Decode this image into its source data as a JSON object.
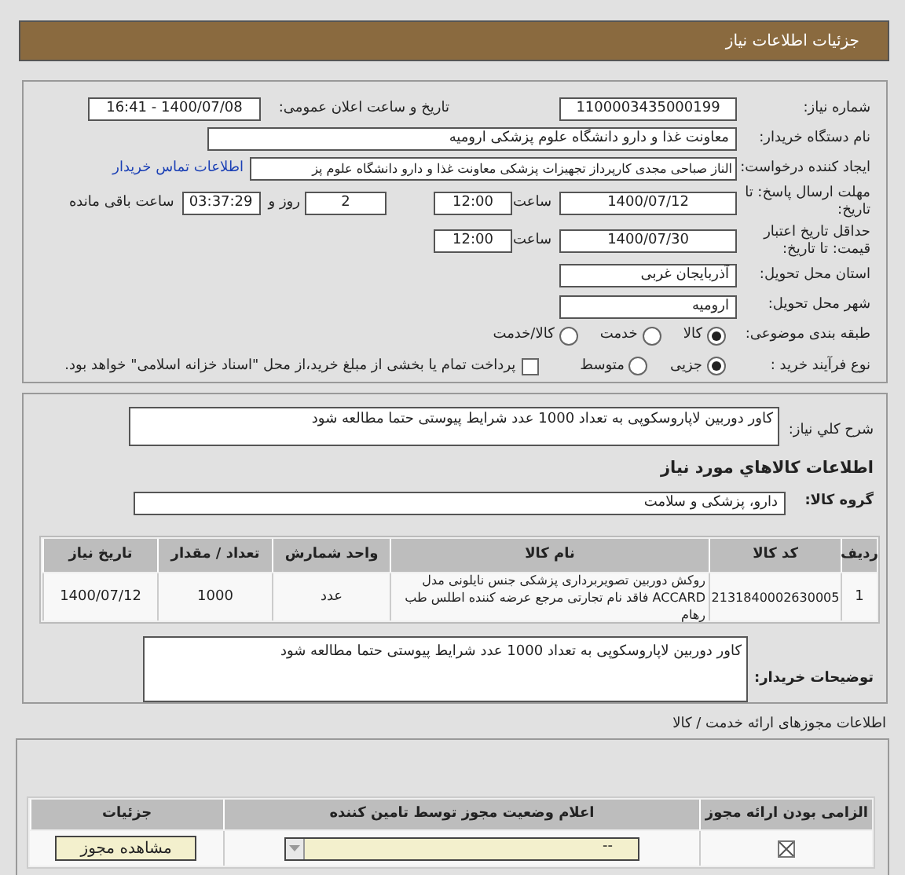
{
  "header": {
    "title": "جزئیات اطلاعات نیاز"
  },
  "need": {
    "number_label": "شماره نیاز:",
    "number": "1100003435000199",
    "announce_label": "تاریخ و ساعت اعلان عمومی:",
    "announce": "1400/07/08 - 16:41",
    "buyer_label": "نام دستگاه خریدار:",
    "buyer": "معاونت غذا و دارو دانشگاه علوم پزشکی ارومیه",
    "creator_label": "ایجاد کننده درخواست:",
    "creator": "الناز صباحی مجدی کارپرداز تجهیزات پزشکی معاونت غذا و دارو دانشگاه علوم پز",
    "contact_link": "اطلاعات تماس خریدار",
    "deadline_label": "مهلت ارسال پاسخ: تا تاریخ:",
    "deadline_date": "1400/07/12",
    "deadline_time_label": "ساعت",
    "deadline_time": "12:00",
    "days": "2",
    "days_label": "روز و",
    "remaining": "03:37:29",
    "remaining_label": "ساعت باقی مانده",
    "validity_label": "حداقل تاریخ اعتبار قیمت: تا تاریخ:",
    "validity_date": "1400/07/30",
    "validity_time_label": "ساعت",
    "validity_time": "12:00",
    "province_label": "استان محل تحویل:",
    "province": "آذربایجان غربی",
    "city_label": "شهر محل تحویل:",
    "city": "ارومیه"
  },
  "classification": {
    "label": "طبقه بندی موضوعی:",
    "options": [
      {
        "label": "کالا",
        "selected": true
      },
      {
        "label": "خدمت",
        "selected": false
      },
      {
        "label": "کالا/خدمت",
        "selected": false
      }
    ]
  },
  "process": {
    "label": "نوع فرآیند خرید :",
    "options": [
      {
        "label": "جزیی",
        "selected": true
      },
      {
        "label": "متوسط",
        "selected": false
      }
    ],
    "treasury": {
      "label": "پرداخت تمام یا بخشی از مبلغ خرید،از محل \"اسناد خزانه اسلامی\" خواهد بود.",
      "checked": false
    }
  },
  "summary": {
    "label": "شرح کلي نياز:",
    "value": "کاور دوربین لاپاروسکوپی به تعداد 1000 عدد شرایط پیوستی حتما مطالعه شود"
  },
  "goods_title": "اطلاعات کالاهاي مورد نياز",
  "goods_group": {
    "label": "گروه کالا:",
    "value": "دارو، پزشکی و سلامت"
  },
  "goods_table": {
    "columns": [
      "ردیف",
      "کد کالا",
      "نام کالا",
      "واحد شمارش",
      "تعداد / مقدار",
      "تاریخ نیاز"
    ],
    "rows": [
      [
        "1",
        "2131840002630005",
        "روکش دوربین تصویربرداری پزشکی جنس نایلونی مدل ACCARD فاقد نام تجارتی مرجع عرضه کننده اطلس طب رهام",
        "عدد",
        "1000",
        "1400/07/12"
      ]
    ]
  },
  "buyer_notes": {
    "label": "توضیحات خریدار:",
    "value": "کاور دوربین لاپاروسکوپی به تعداد 1000 عدد شرایط پیوستی حتما مطالعه شود"
  },
  "permits_title": "اطلاعات مجوزهای ارائه خدمت / کالا",
  "permits_table": {
    "columns": [
      "الزامی بودن ارائه مجوز",
      "اعلام وضعیت مجوز توسط تامین کننده",
      "جزئیات"
    ],
    "rows": [
      {
        "required": true,
        "status": "--",
        "button": "مشاهده مجوز"
      }
    ]
  }
}
